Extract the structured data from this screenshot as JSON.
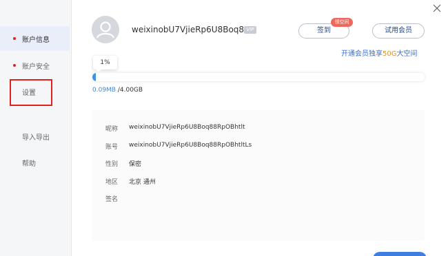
{
  "sidebar": {
    "items": [
      {
        "label": "账户信息",
        "active": true,
        "bullet": true
      },
      {
        "label": "账户安全",
        "active": false,
        "bullet": true
      },
      {
        "label": "设置",
        "active": false,
        "bullet": false
      },
      {
        "label": "导入导出",
        "active": false,
        "bullet": false
      },
      {
        "label": "帮助",
        "active": false,
        "bullet": false
      }
    ]
  },
  "profile": {
    "username": "weixinobU7VjieRp6U8Boq88..",
    "vip_label": "VIP",
    "icon": "user-avatar-icon"
  },
  "actions": {
    "signin_label": "签到",
    "signin_badge": "领空间",
    "trial_label": "试用会员"
  },
  "promo": {
    "text_prefix": "开通会员独享",
    "highlight": "50G",
    "text_suffix": "大空间"
  },
  "storage": {
    "percent_label": "1%",
    "fill_fraction": 0.01,
    "used": "0.09MB",
    "total": " /4.00GB"
  },
  "info": [
    {
      "key": "昵称",
      "value": "weixinobU7VjieRp6U8Boq88RpOBhtlt"
    },
    {
      "key": "账号",
      "value": "weixinobU7VjieRp6U8Boq88RpOBhtltLs"
    },
    {
      "key": "性别",
      "value": "保密"
    },
    {
      "key": "地区",
      "value": "北京 通州"
    },
    {
      "key": "签名",
      "value": ""
    }
  ],
  "colors": {
    "accent": "#3d87d8",
    "bullet": "#e0211d",
    "highlight_box": "#e0211d",
    "promo_highlight": "#d29530",
    "badge": "#ec6a5d"
  }
}
